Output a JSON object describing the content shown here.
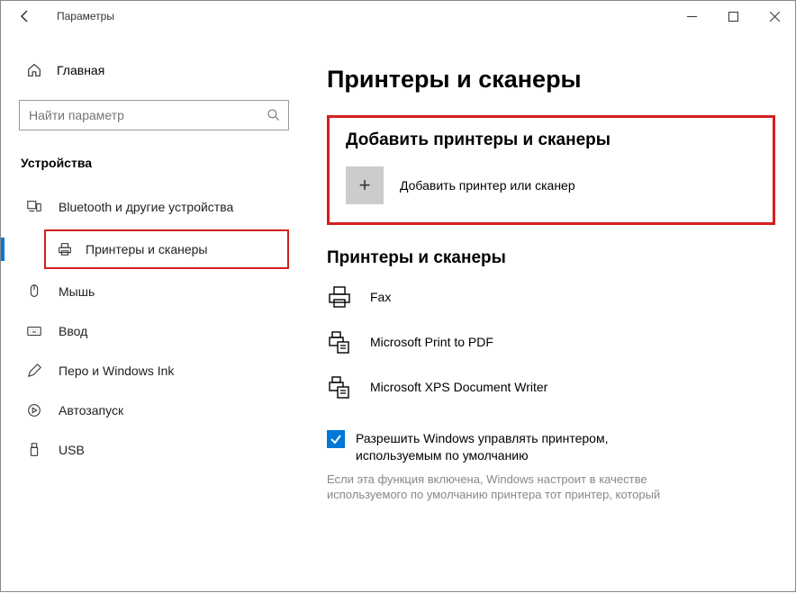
{
  "window": {
    "title": "Параметры",
    "page_title": "Принтеры и сканеры"
  },
  "sidebar": {
    "home_label": "Главная",
    "search_placeholder": "Найти параметр",
    "category_header": "Устройства",
    "items": {
      "bluetooth": "Bluetooth и другие устройства",
      "printers": "Принтеры и сканеры",
      "mouse": "Мышь",
      "input": "Ввод",
      "pen": "Перо и Windows Ink",
      "autorun": "Автозапуск",
      "usb": "USB"
    }
  },
  "main": {
    "add_section_title": "Добавить принтеры и сканеры",
    "add_button_label": "Добавить принтер или сканер",
    "list_section_title": "Принтеры и сканеры",
    "devices": {
      "fax": "Fax",
      "mpdf": "Microsoft Print to PDF",
      "mxps": "Microsoft XPS Document Writer"
    },
    "checkbox_label": "Разрешить Windows управлять принтером, используемым по умолчанию",
    "note_text": "Если эта функция включена, Windows настроит в качестве используемого по умолчанию принтера тот принтер, который"
  }
}
